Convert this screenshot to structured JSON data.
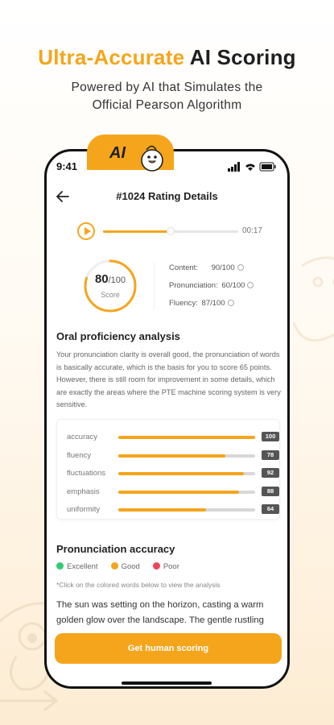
{
  "hero": {
    "title_accent": "Ultra-Accurate",
    "title_rest": "AI Scoring",
    "subtitle_line1": "Powered by AI that Simulates the",
    "subtitle_line2": "Official Pearson Algorithm",
    "accent_color": "#f5a51c"
  },
  "badge": {
    "label": "AI",
    "icon": "duck-mascot-icon"
  },
  "status_bar": {
    "time": "9:41",
    "icons": [
      "signal-icon",
      "wifi-icon",
      "battery-icon"
    ]
  },
  "nav": {
    "title": "#1024 Rating Details",
    "back_icon": "back-arrow-icon"
  },
  "player": {
    "time": "00:17",
    "progress": 0.5,
    "play_icon": "play-icon"
  },
  "score": {
    "value": "80",
    "max": "/100",
    "label": "Score",
    "fraction": 0.8,
    "metrics": [
      {
        "label": "Content:",
        "value": "90/100"
      },
      {
        "label": "Pronunciation:",
        "value": "60/100"
      },
      {
        "label": "Fluency:",
        "value": "87/100"
      }
    ]
  },
  "analysis": {
    "title": "Oral proficiency analysis",
    "text": "Your pronunciation clarity is overall good, the pronunciation of words is basically accurate, which is the basis for you to score 65 points. However, there is still room for improvement in some details, which are exactly the areas where the PTE machine scoring system is very sensitive.",
    "bars": [
      {
        "label": "accuracy",
        "value": 100
      },
      {
        "label": "fluency",
        "value": 78
      },
      {
        "label": "fluctuations",
        "value": 92
      },
      {
        "label": "emphasis",
        "value": 88
      },
      {
        "label": "uniformity",
        "value": 64
      }
    ]
  },
  "pronunciation": {
    "title": "Pronunciation accuracy",
    "legend": [
      {
        "label": "Excellent",
        "color": "#2ecc71"
      },
      {
        "label": "Good",
        "color": "#f5a51c"
      },
      {
        "label": "Poor",
        "color": "#f0435a"
      }
    ],
    "hint": "*Click on the colored words below to view the analysis",
    "passage": "The sun was setting on the horizon, casting a warm golden glow over the landscape. The gentle rustling"
  },
  "cta": {
    "label": "Get human scoring"
  }
}
